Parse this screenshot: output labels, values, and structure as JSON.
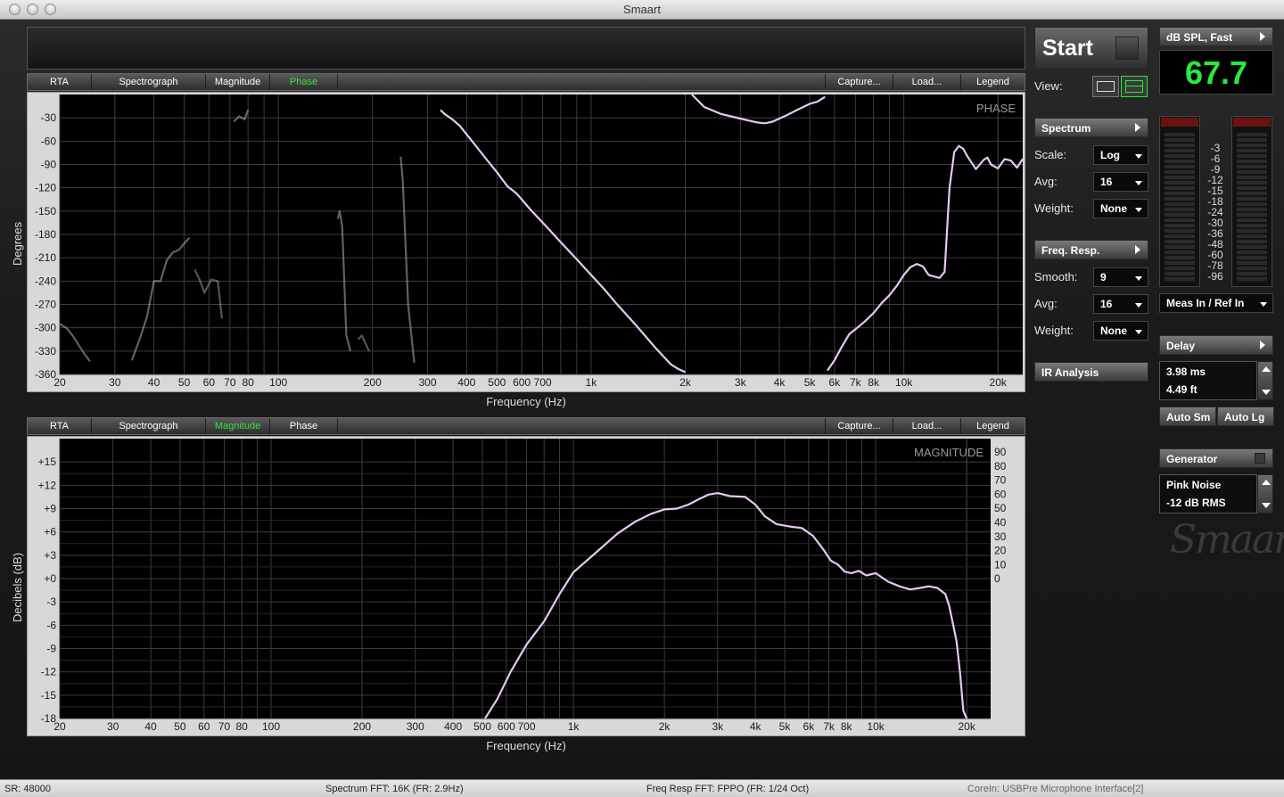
{
  "window": {
    "title": "Smaart"
  },
  "tabs_top": {
    "items": [
      "RTA",
      "Spectrograph",
      "Magnitude",
      "Phase"
    ],
    "active": "Phase",
    "right_items": [
      "Capture...",
      "Load...",
      "Legend"
    ]
  },
  "tabs_bottom": {
    "items": [
      "RTA",
      "Spectrograph",
      "Magnitude",
      "Phase"
    ],
    "active": "Magnitude",
    "right_items": [
      "Capture...",
      "Load...",
      "Legend"
    ]
  },
  "sidebar": {
    "start_label": "Start",
    "view_label": "View:",
    "spectrum_label": "Spectrum",
    "scale_label": "Scale:",
    "scale_value": "Log",
    "avg_label": "Avg:",
    "spec_avg_value": "16",
    "weight_label": "Weight:",
    "spec_weight_value": "None",
    "freqresp_label": "Freq. Resp.",
    "smooth_label": "Smooth:",
    "smooth_value": "9",
    "fr_avg_value": "16",
    "fr_weight_value": "None",
    "ir_label": "IR Analysis"
  },
  "meter": {
    "mode_label": "dB SPL, Fast",
    "value": "67.7",
    "scale": [
      "-3",
      "-6",
      "-9",
      "-12",
      "-15",
      "-18",
      "-24",
      "-30",
      "-36",
      "-48",
      "-60",
      "-78",
      "-96"
    ],
    "input_label": "Meas In / Ref In"
  },
  "delay": {
    "label": "Delay",
    "ms": "3.98 ms",
    "ft": "4.49 ft",
    "auto_sm": "Auto Sm",
    "auto_lg": "Auto Lg"
  },
  "generator": {
    "label": "Generator",
    "signal": "Pink Noise",
    "level": "-12 dB  RMS"
  },
  "logo_text": "Smaart",
  "status": {
    "sr": "SR: 48000",
    "spectrum_fft": "Spectrum FFT: 16K (FR: 2.9Hz)",
    "fr_fft": "Freq Resp FFT: FPPO (FR: 1/24 Oct)",
    "core": "CoreIn: USBPre Microphone Interface[2]"
  },
  "colors": {
    "trace": "#e6c8f2",
    "accent_green": "#39e03c",
    "plot_bg": "#000000"
  },
  "chart_data": [
    {
      "type": "line",
      "title": "PHASE",
      "xlabel": "Frequency (Hz)",
      "ylabel": "Degrees",
      "xscale": "log",
      "xlim": [
        20,
        24000
      ],
      "ylim": [
        -360,
        0
      ],
      "xticks": [
        20,
        30,
        40,
        50,
        60,
        70,
        80,
        100,
        200,
        300,
        400,
        500,
        600,
        700,
        1000,
        2000,
        3000,
        4000,
        5000,
        6000,
        7000,
        8000,
        10000,
        20000
      ],
      "xtick_labels": [
        "20",
        "30",
        "40",
        "50",
        "60",
        "70",
        "80",
        "100",
        "200",
        "300",
        "400",
        "500",
        "600",
        "700",
        "1k",
        "2k",
        "3k",
        "4k",
        "5k",
        "6k",
        "7k",
        "8k",
        "10k",
        "20k"
      ],
      "yticks": [
        -30,
        -60,
        -90,
        -120,
        -150,
        -180,
        -210,
        -240,
        -270,
        -300,
        -330,
        -360
      ],
      "ytick_labels": [
        "-30",
        "-60",
        "-90",
        "-120",
        "-150",
        "-180",
        "-210",
        "-240",
        "-270",
        "-300",
        "-330",
        "-360"
      ],
      "grid": true,
      "series": [
        {
          "values": [
            [
              330,
              -20
            ],
            [
              340,
              -25
            ],
            [
              360,
              -32
            ],
            [
              380,
              -40
            ],
            [
              420,
              -62
            ],
            [
              460,
              -82
            ],
            [
              500,
              -100
            ],
            [
              540,
              -118
            ],
            [
              560,
              -123
            ],
            [
              580,
              -128
            ],
            [
              640,
              -148
            ],
            [
              720,
              -170
            ],
            [
              800,
              -190
            ],
            [
              900,
              -212
            ],
            [
              1000,
              -232
            ],
            [
              1100,
              -250
            ],
            [
              1200,
              -268
            ],
            [
              1400,
              -298
            ],
            [
              1600,
              -325
            ],
            [
              1800,
              -347
            ],
            [
              1900,
              -353
            ],
            [
              2000,
              -357
            ]
          ],
          "opacity": 1
        },
        {
          "values": [
            [
              2100,
              0
            ],
            [
              2300,
              -16
            ],
            [
              2600,
              -25
            ],
            [
              3000,
              -31
            ],
            [
              3400,
              -36
            ],
            [
              3600,
              -37
            ],
            [
              3800,
              -35
            ],
            [
              4200,
              -27
            ],
            [
              4600,
              -19
            ],
            [
              5000,
              -12
            ],
            [
              5300,
              -9
            ],
            [
              5600,
              -3
            ]
          ],
          "opacity": 1
        },
        {
          "values": [
            [
              5700,
              -355
            ],
            [
              6000,
              -342
            ],
            [
              6300,
              -326
            ],
            [
              6700,
              -308
            ],
            [
              7000,
              -302
            ],
            [
              7500,
              -292
            ],
            [
              8000,
              -281
            ],
            [
              8500,
              -268
            ],
            [
              9000,
              -258
            ],
            [
              9500,
              -246
            ],
            [
              10000,
              -232
            ],
            [
              10500,
              -222
            ],
            [
              11000,
              -218
            ],
            [
              11500,
              -221
            ],
            [
              12000,
              -232
            ],
            [
              13000,
              -236
            ],
            [
              13500,
              -228
            ],
            [
              14000,
              -120
            ],
            [
              14500,
              -74
            ],
            [
              15000,
              -66
            ],
            [
              15500,
              -70
            ],
            [
              16000,
              -80
            ],
            [
              17000,
              -96
            ],
            [
              18000,
              -84
            ],
            [
              18500,
              -81
            ],
            [
              19000,
              -90
            ],
            [
              20000,
              -95
            ],
            [
              21000,
              -83
            ],
            [
              22000,
              -85
            ],
            [
              23000,
              -94
            ],
            [
              24000,
              -83
            ]
          ],
          "opacity": 1
        },
        {
          "values": [
            [
              20,
              -295
            ],
            [
              21,
              -300
            ],
            [
              22,
              -310
            ],
            [
              24,
              -334
            ],
            [
              25,
              -343
            ]
          ],
          "opacity": 0.45
        },
        {
          "values": [
            [
              34,
              -342
            ],
            [
              36,
              -315
            ],
            [
              38,
              -286
            ],
            [
              40,
              -240
            ],
            [
              42,
              -240
            ],
            [
              44,
              -213
            ],
            [
              46,
              -203
            ],
            [
              48,
              -200
            ],
            [
              52,
              -184
            ]
          ],
          "opacity": 0.45
        },
        {
          "values": [
            [
              54,
              -225
            ],
            [
              56,
              -238
            ],
            [
              58,
              -255
            ],
            [
              61,
              -238
            ],
            [
              64,
              -240
            ],
            [
              66,
              -288
            ]
          ],
          "opacity": 0.4
        },
        {
          "values": [
            [
              72,
              -35
            ],
            [
              75,
              -28
            ],
            [
              78,
              -32
            ],
            [
              80,
              -20
            ]
          ],
          "opacity": 0.45
        },
        {
          "values": [
            [
              155,
              -160
            ],
            [
              157,
              -150
            ],
            [
              160,
              -170
            ],
            [
              165,
              -310
            ],
            [
              170,
              -330
            ]
          ],
          "opacity": 0.45
        },
        {
          "values": [
            [
              180,
              -315
            ],
            [
              185,
              -310
            ],
            [
              195,
              -330
            ]
          ],
          "opacity": 0.4
        },
        {
          "values": [
            [
              246,
              -80
            ],
            [
              250,
              -110
            ],
            [
              260,
              -270
            ],
            [
              272,
              -345
            ]
          ],
          "opacity": 0.45
        }
      ]
    },
    {
      "type": "line",
      "title": "MAGNITUDE",
      "xlabel": "Frequency (Hz)",
      "ylabel": "Decibels (dB)",
      "xscale": "log",
      "xlim": [
        20,
        24000
      ],
      "ylim": [
        -18,
        18
      ],
      "xticks": [
        20,
        30,
        40,
        50,
        60,
        70,
        80,
        100,
        200,
        300,
        400,
        500,
        600,
        700,
        1000,
        2000,
        3000,
        4000,
        5000,
        6000,
        7000,
        8000,
        10000,
        20000
      ],
      "xtick_labels": [
        "20",
        "30",
        "40",
        "50",
        "60",
        "70",
        "80",
        "100",
        "200",
        "300",
        "400",
        "500",
        "600",
        "700",
        "1k",
        "2k",
        "3k",
        "4k",
        "5k",
        "6k",
        "7k",
        "8k",
        "10k",
        "20k"
      ],
      "yticks": [
        15,
        12,
        9,
        6,
        3,
        0,
        -3,
        -6,
        -9,
        -12,
        -15,
        -18
      ],
      "ytick_labels": [
        "+15",
        "+12",
        "+9",
        "+6",
        "+3",
        "+0",
        "-3",
        "-6",
        "-9",
        "-12",
        "-15",
        "-18"
      ],
      "y2ticks": [
        90,
        80,
        70,
        60,
        50,
        40,
        30,
        20,
        10,
        0
      ],
      "y2tick_labels": [
        "90",
        "80",
        "70",
        "60",
        "50",
        "40",
        "30",
        "20",
        "10",
        "0"
      ],
      "grid": true,
      "series": [
        {
          "values": [
            [
              510,
              -18
            ],
            [
              560,
              -15.5
            ],
            [
              620,
              -12
            ],
            [
              700,
              -8.5
            ],
            [
              800,
              -5.5
            ],
            [
              900,
              -2
            ],
            [
              1000,
              0.8
            ],
            [
              1200,
              3.5
            ],
            [
              1400,
              5.8
            ],
            [
              1600,
              7.3
            ],
            [
              1800,
              8.3
            ],
            [
              2000,
              8.9
            ],
            [
              2200,
              9
            ],
            [
              2400,
              9.5
            ],
            [
              2600,
              10.2
            ],
            [
              2800,
              10.8
            ],
            [
              3000,
              11
            ],
            [
              3300,
              10.6
            ],
            [
              3700,
              10.5
            ],
            [
              4000,
              9.5
            ],
            [
              4300,
              8
            ],
            [
              4700,
              7
            ],
            [
              5200,
              6.7
            ],
            [
              5700,
              6.5
            ],
            [
              6200,
              5.5
            ],
            [
              6700,
              3.8
            ],
            [
              7100,
              2.3
            ],
            [
              7500,
              1.8
            ],
            [
              7900,
              0.9
            ],
            [
              8300,
              0.7
            ],
            [
              8800,
              1
            ],
            [
              9300,
              0.4
            ],
            [
              10000,
              0.7
            ],
            [
              11000,
              -0.4
            ],
            [
              12000,
              -1
            ],
            [
              13000,
              -1.4
            ],
            [
              14000,
              -1.2
            ],
            [
              15000,
              -1
            ],
            [
              16000,
              -1.2
            ],
            [
              17000,
              -2
            ],
            [
              17500,
              -3.5
            ],
            [
              18500,
              -8
            ],
            [
              19000,
              -12
            ],
            [
              19500,
              -17
            ],
            [
              20000,
              -18
            ]
          ],
          "opacity": 1
        }
      ]
    }
  ]
}
